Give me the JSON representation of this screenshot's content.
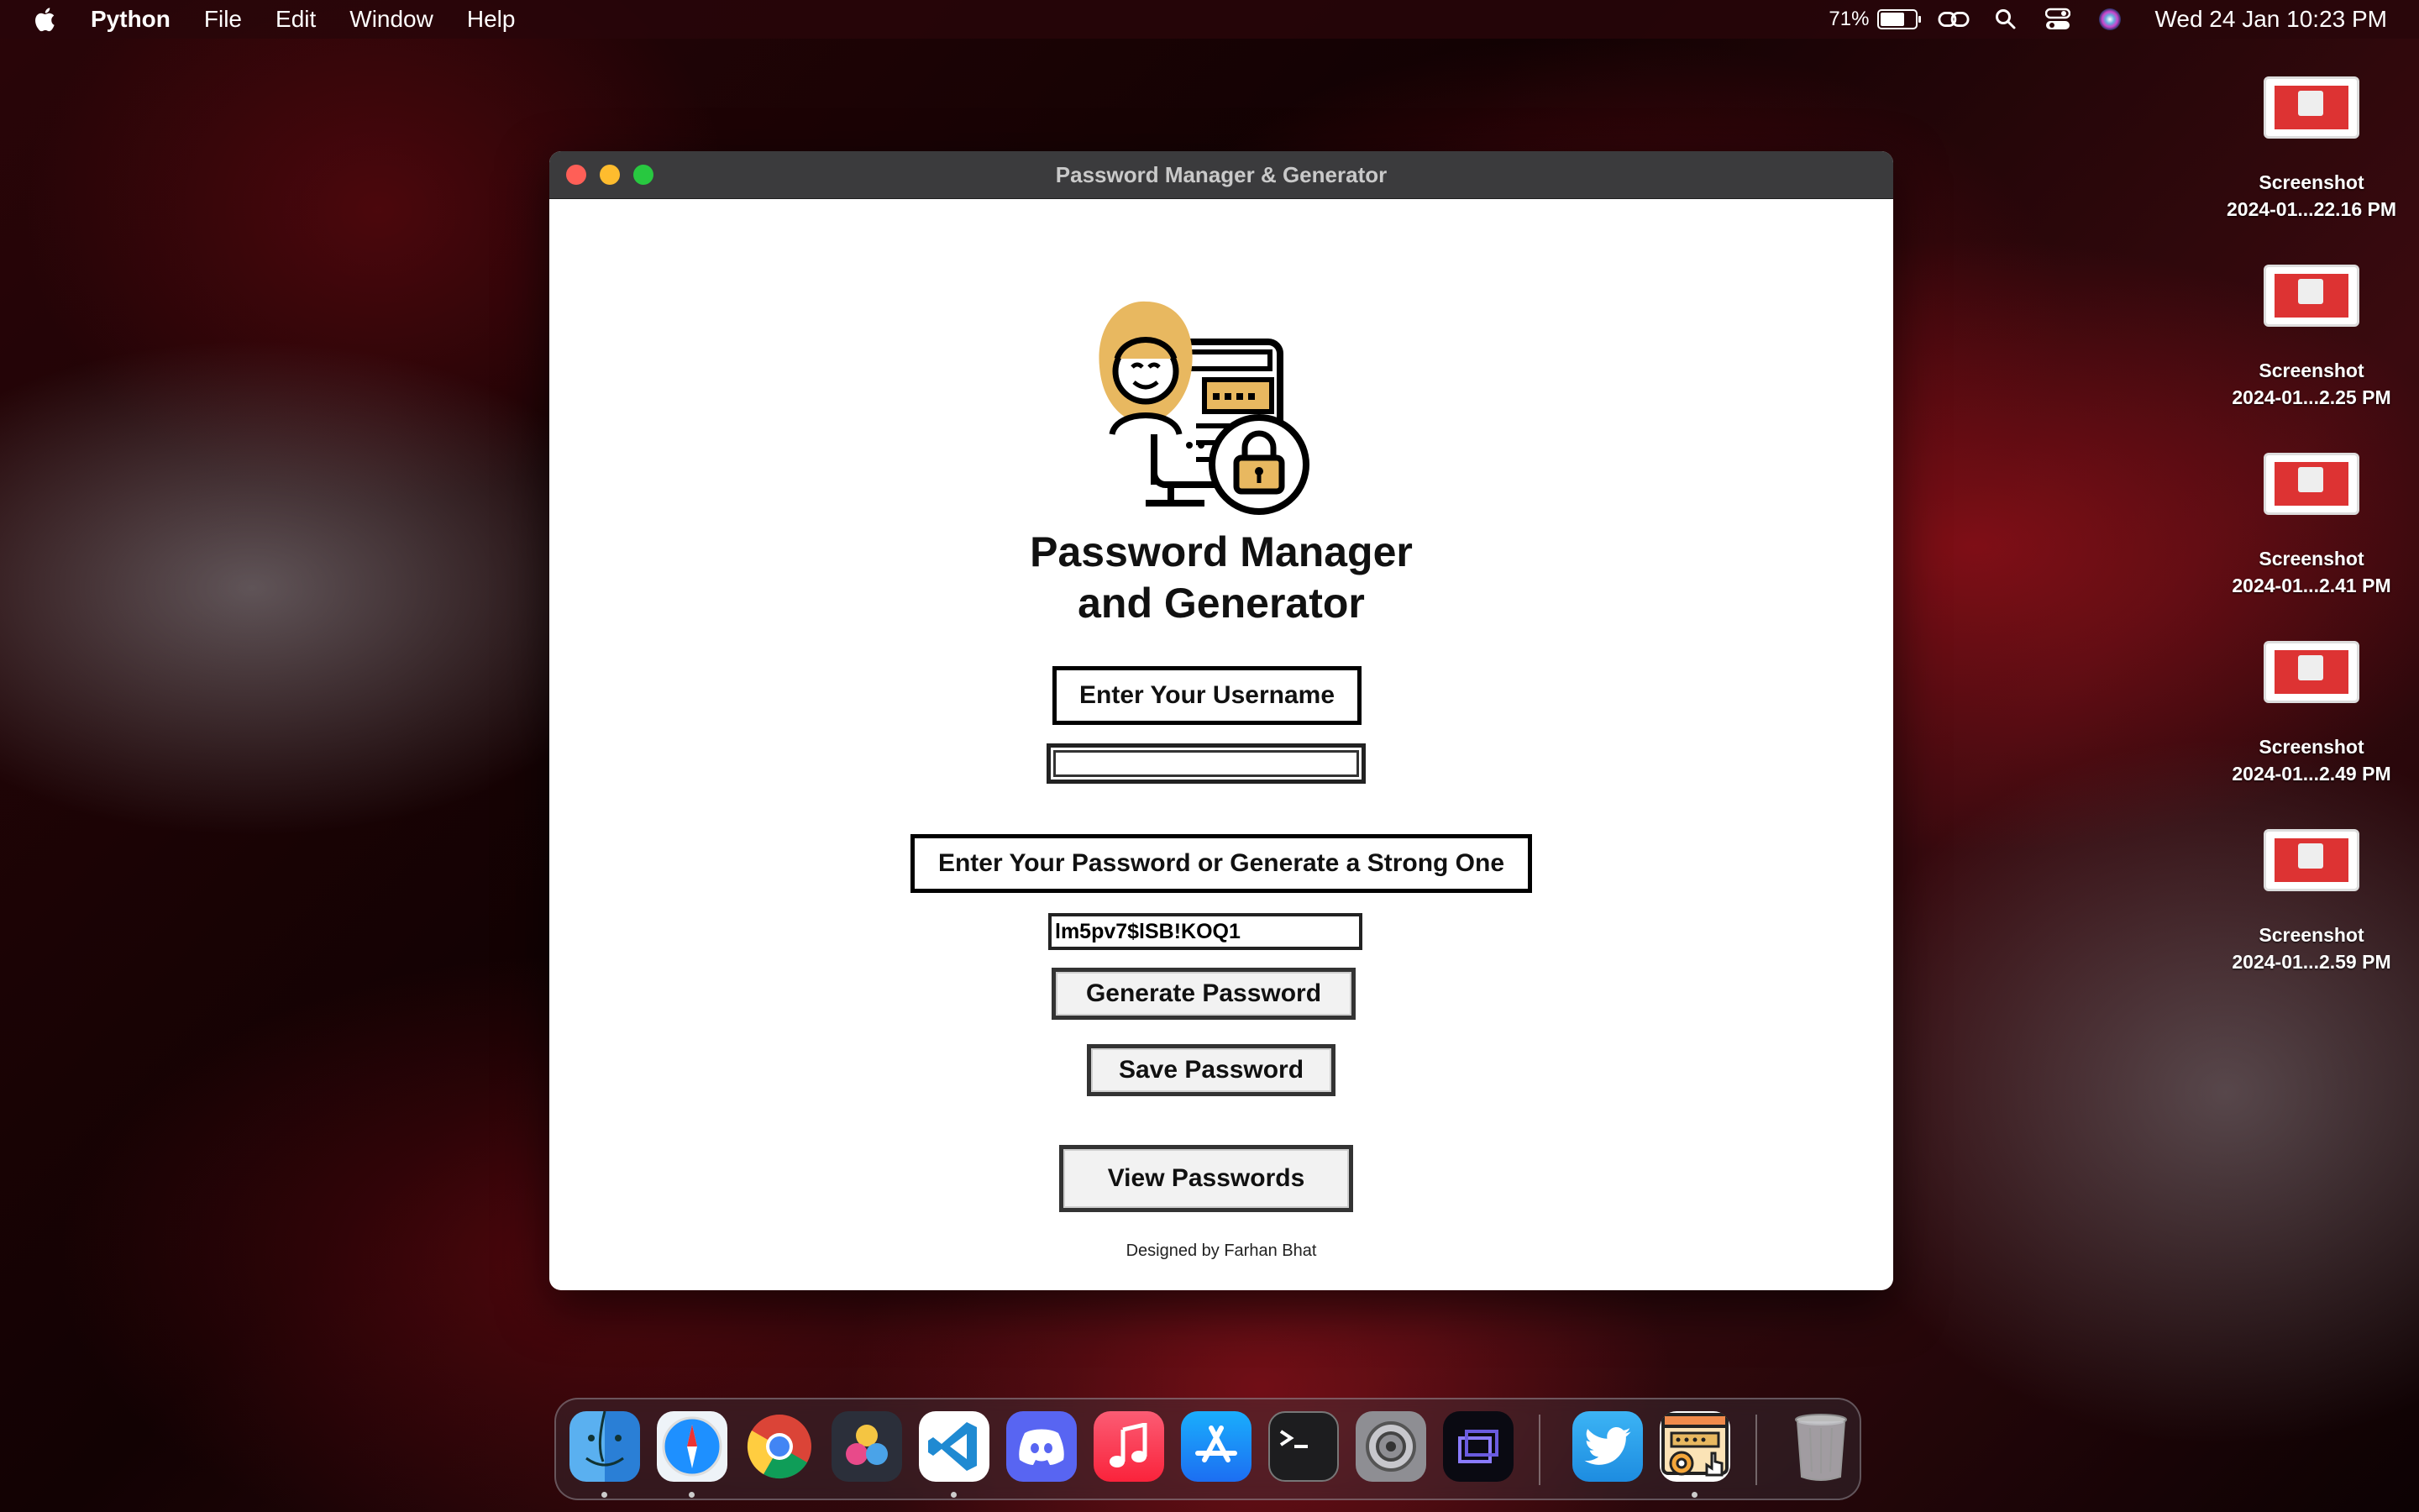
{
  "menubar": {
    "app_name": "Python",
    "menus": [
      "File",
      "Edit",
      "Window",
      "Help"
    ],
    "battery_percent": "71%",
    "battery_level": 0.71,
    "datetime": "Wed 24 Jan  10:23 PM"
  },
  "desktop": {
    "files": [
      {
        "line1": "Screenshot",
        "line2": "2024-01...22.16 PM"
      },
      {
        "line1": "Screenshot",
        "line2": "2024-01...2.25 PM"
      },
      {
        "line1": "Screenshot",
        "line2": "2024-01...2.41 PM"
      },
      {
        "line1": "Screenshot",
        "line2": "2024-01...2.49 PM"
      },
      {
        "line1": "Screenshot",
        "line2": "2024-01...2.59 PM"
      }
    ]
  },
  "window": {
    "title": "Password Manager & Generator",
    "heading_line1": "Password Manager",
    "heading_line2": "and Generator",
    "username_label": "Enter Your Username",
    "username_value": "",
    "password_label": "Enter Your Password or Generate a Strong One",
    "password_value": "lm5pv7$lSB!KOQ1",
    "generate_button": "Generate Password",
    "save_button": "Save Password",
    "view_button": "View Passwords",
    "footer": "Designed by Farhan Bhat"
  },
  "dock": {
    "apps": [
      "finder-icon",
      "safari-icon",
      "chrome-icon",
      "davinci-resolve-icon",
      "vscode-icon",
      "discord-icon",
      "music-icon",
      "app-store-icon",
      "terminal-icon",
      "system-settings-icon",
      "screen-capture-icon",
      "twitter-icon",
      "python-app-icon",
      "trash-icon"
    ],
    "colors": {
      "finder": "#3a8dde",
      "safari": "#1e90ff",
      "discord": "#5865f2",
      "music": "#fa3c4c",
      "app_store": "#1c8ef9",
      "twitter": "#1da1f2"
    }
  }
}
